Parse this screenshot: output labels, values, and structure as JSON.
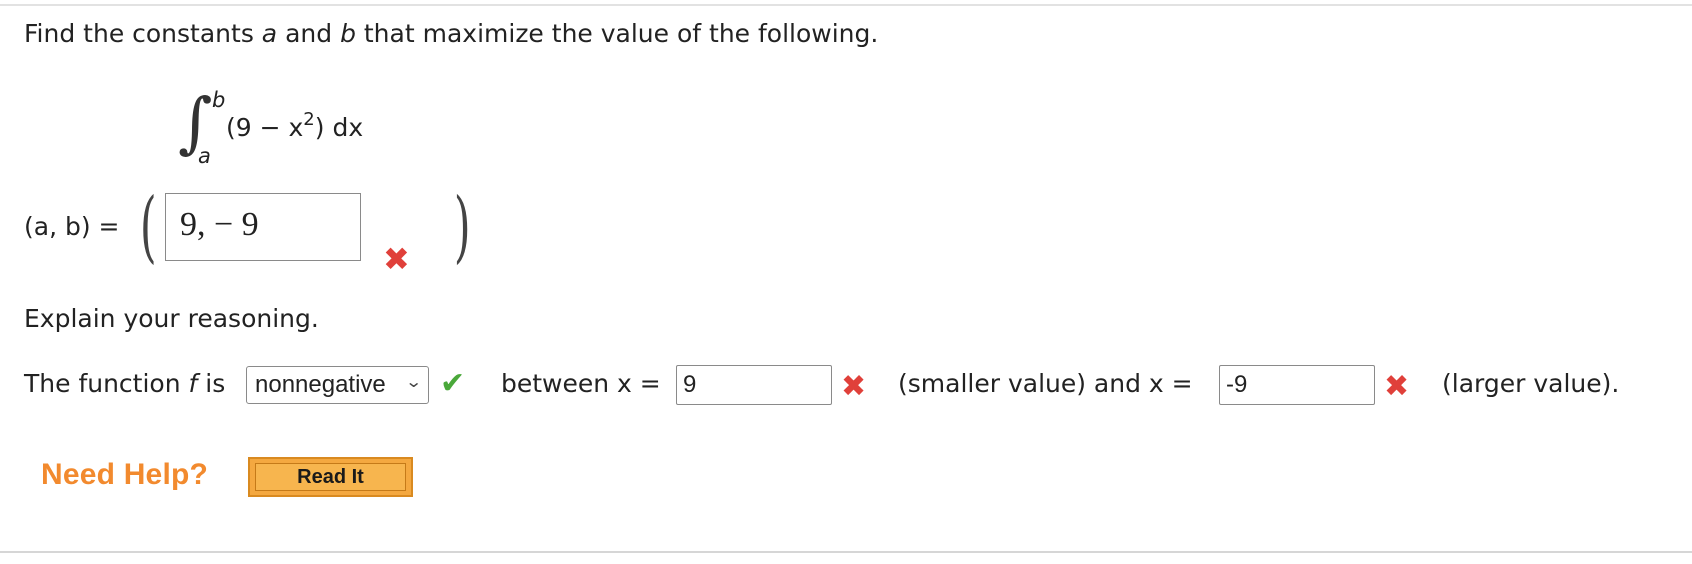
{
  "question": {
    "prompt_start": "Find the constants ",
    "var_a": "a",
    "and_word": " and ",
    "var_b": "b",
    "prompt_end": " that maximize the value of the following."
  },
  "integral": {
    "upper_limit": "b",
    "lower_limit": "a",
    "integrand_start": "(9 − x",
    "exponent": "2",
    "integrand_end": ") dx"
  },
  "answer": {
    "label": "(a, b) =",
    "value": "9,  − 9",
    "status": "incorrect"
  },
  "explain": {
    "heading": "Explain your reasoning.",
    "sentence_start": "The function ",
    "func_var": "f",
    "is_word": " is",
    "select_value": "nonnegative",
    "select_status": "correct",
    "between_label": "between x =",
    "input1_value": "9",
    "input1_status": "incorrect",
    "mid_label": "(smaller value) and x =",
    "input2_value": "-9",
    "input2_status": "incorrect",
    "end_label": "(larger value)."
  },
  "help": {
    "need_help": "Need Help?",
    "read_it": "Read It"
  },
  "colors": {
    "incorrect": "#e0403a",
    "correct": "#4aa83a",
    "help_orange": "#f28a2e",
    "button_orange": "#f4a840"
  },
  "icons": {
    "incorrect": "x-mark-icon",
    "correct": "check-mark-icon",
    "dropdown": "chevron-down-icon"
  }
}
